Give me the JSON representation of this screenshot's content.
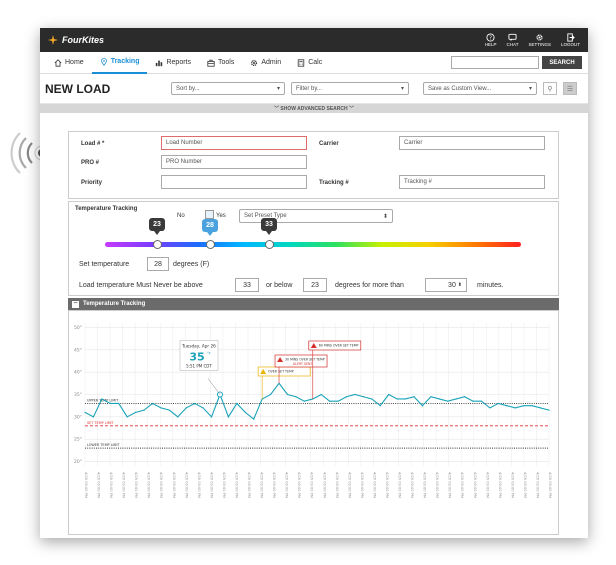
{
  "app": {
    "brand": "FourKites",
    "top_icons": [
      {
        "label": "HELP",
        "icon": "help-icon"
      },
      {
        "label": "CHAT",
        "icon": "chat-icon"
      },
      {
        "label": "SETTINGS",
        "icon": "settings-icon"
      },
      {
        "label": "LOGOUT",
        "icon": "logout-icon"
      }
    ]
  },
  "nav": {
    "items": [
      {
        "label": "Home",
        "icon": "home-icon"
      },
      {
        "label": "Tracking",
        "icon": "location-pin-icon",
        "active": true
      },
      {
        "label": "Reports",
        "icon": "bar-chart-icon"
      },
      {
        "label": "Tools",
        "icon": "toolbox-icon"
      },
      {
        "label": "Admin",
        "icon": "gear-icon"
      },
      {
        "label": "Calc",
        "icon": "calculator-icon"
      }
    ],
    "search_value": "",
    "search_button": "SEARCH"
  },
  "header": {
    "title": "NEW LOAD",
    "sort_by": "Sort by...",
    "filter_by": "Filter by...",
    "save_view": "Save as Custom View...",
    "advanced": "SHOW ADVANCED SEARCH"
  },
  "form": {
    "load_label": "Load # *",
    "load_placeholder": "Load Number",
    "pro_label": "PRO #",
    "pro_placeholder": "PRO Number",
    "priority_label": "Priority",
    "carrier_label": "Carrier",
    "carrier_placeholder": "Carrier",
    "tracking_label": "Tracking #",
    "tracking_placeholder": "Tracking #"
  },
  "temperature": {
    "title": "Temperature Tracking",
    "no_label": "No",
    "yes_label": "Yes",
    "preset_placeholder": "Set Preset Type",
    "slider_values": [
      "23",
      "28",
      "33"
    ],
    "set_label": "Set temperature",
    "set_value": "28",
    "degrees_label": "degrees (F)",
    "never_label": "Load temperature Must Never be above",
    "above_value": "33",
    "or_below": "or below",
    "below_value": "23",
    "more_than": "degrees for more than",
    "minutes_value": "30",
    "minutes_label": "minutes.",
    "colors": {
      "low": "#3a3a3a",
      "set": "#4aa3df",
      "high": "#3a3a3a"
    }
  },
  "chart_panel": {
    "title": "Temperature Tracking"
  },
  "chart_data": {
    "type": "line",
    "yticks": [
      20,
      25,
      30,
      35,
      40,
      45,
      50
    ],
    "ylim": [
      19,
      51
    ],
    "x_count": 38,
    "series": [
      {
        "values": [
          31,
          30,
          34,
          33,
          33,
          30,
          31,
          31.5,
          33,
          32,
          31.5,
          30,
          32,
          33,
          32,
          30,
          35,
          30,
          33,
          31,
          29.5,
          34,
          35,
          37.5,
          35,
          34.5,
          33.5,
          34,
          35,
          33.5,
          33.5,
          34.5,
          35,
          34.5,
          34,
          32.5,
          35,
          34,
          34,
          34.5,
          32.5,
          34.5,
          34,
          33.5,
          34,
          34.5,
          33.5,
          33.5,
          32,
          33,
          32.5,
          32,
          32.5,
          32.5,
          32,
          31.5
        ]
      }
    ],
    "thresholds": [
      {
        "label": "UPPER TEMP LIMIT",
        "value": 33,
        "style": "dotted",
        "color": "#333333"
      },
      {
        "label": "SET TEMP LIMIT",
        "value": 28,
        "style": "dashed",
        "color": "#e03030"
      },
      {
        "label": "LOWER TEMP LIMIT",
        "value": 23,
        "style": "dotted",
        "color": "#333333"
      }
    ],
    "line_color": "#1aa3b8",
    "tooltip": {
      "day": "Tuesday, Apr 26",
      "value": "35",
      "unit": "°F",
      "time": "5:51 PM CDT"
    },
    "alerts": [
      {
        "text": "OVER SET TEMP",
        "color": "#e8b400"
      },
      {
        "text": "30 MINS OVER SET TEMP",
        "sub": "ALERT SENT",
        "color": "#d32f2f"
      },
      {
        "text": "60 MINS OVER SET TEMP",
        "color": "#d32f2f"
      }
    ]
  }
}
